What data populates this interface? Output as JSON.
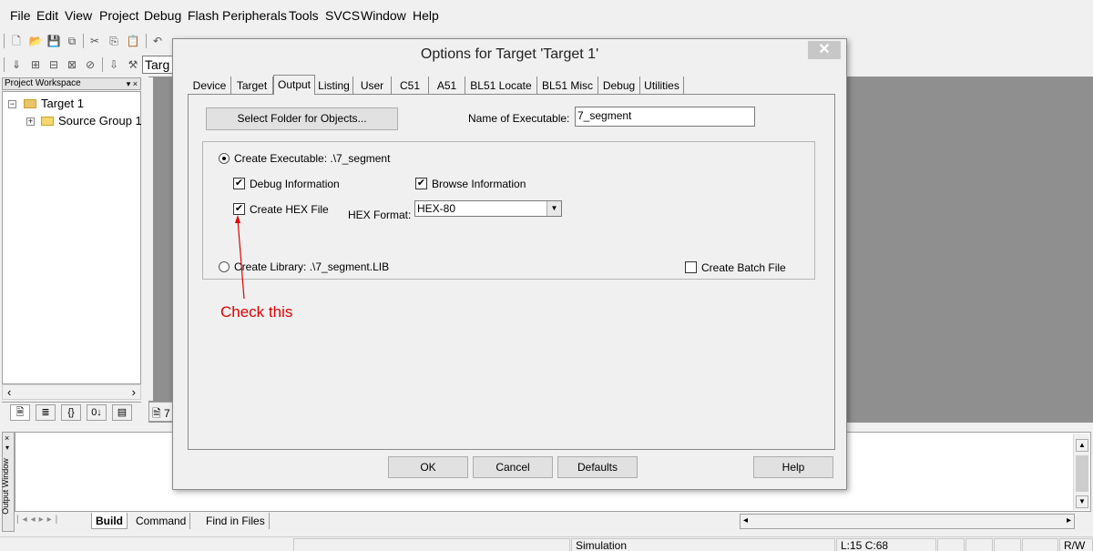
{
  "menu": [
    "File",
    "Edit",
    "View",
    "Project",
    "Debug",
    "Flash",
    "Peripherals",
    "Tools",
    "SVCS",
    "Window",
    "Help"
  ],
  "toolbar": {
    "target_combo": "Targ"
  },
  "workspace": {
    "title": "Project Workspace",
    "title_controls": "▾ ×",
    "tree": [
      {
        "label": "Target 1",
        "toggle": "⊟"
      },
      {
        "label": "Source Group 1",
        "toggle": "⊞"
      }
    ],
    "tabs": [
      "🗎",
      "≣",
      "{}",
      "0↓",
      "▤"
    ]
  },
  "editor": {
    "tab_label": "7"
  },
  "output": {
    "label": "Output Window",
    "tabs": [
      "Build",
      "Command",
      "Find in Files"
    ]
  },
  "status": {
    "mode": "Simulation",
    "position": "L:15 C:68",
    "access": "R/W"
  },
  "dialog": {
    "title": "Options for Target 'Target 1'",
    "close": "✕",
    "tabs": [
      "Device",
      "Target",
      "Output",
      "Listing",
      "User",
      "C51",
      "A51",
      "BL51 Locate",
      "BL51 Misc",
      "Debug",
      "Utilities"
    ],
    "active_tab": "Output",
    "select_folder_button": "Select Folder for Objects...",
    "name_of_executable_label": "Name of Executable:",
    "name_of_executable_value": "7_segment",
    "create_executable_label": "Create Executable:  .\\7_segment",
    "debug_info_label": "Debug Information",
    "browse_info_label": "Browse Information",
    "create_hex_label": "Create HEX File",
    "hex_format_label": "HEX Format:",
    "hex_format_value": "HEX-80",
    "create_library_label": "Create Library:  .\\7_segment.LIB",
    "create_batch_label": "Create Batch File",
    "ok": "OK",
    "cancel": "Cancel",
    "defaults": "Defaults",
    "help": "Help"
  },
  "annotation": {
    "text": "Check this",
    "color": "#e00000"
  }
}
